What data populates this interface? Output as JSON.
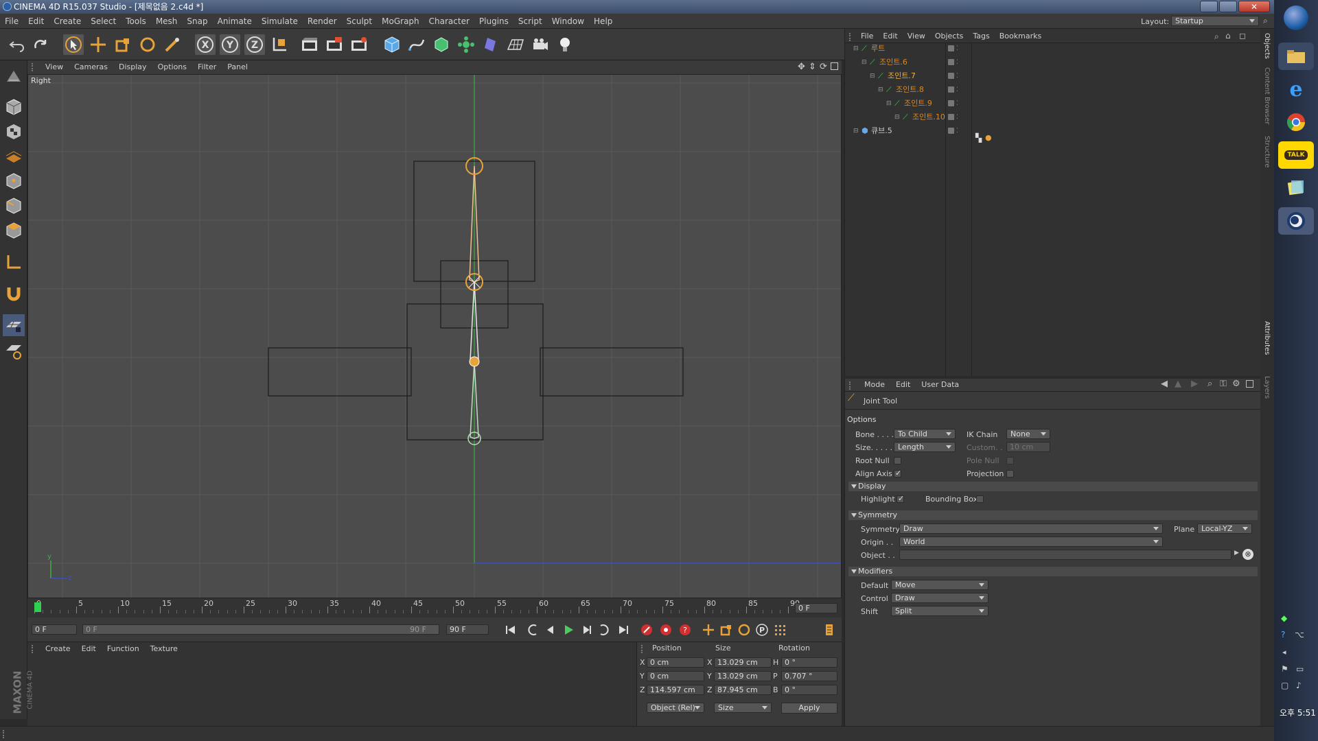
{
  "window": {
    "title": "CINEMA 4D R15.037 Studio - [제목없음 2.c4d *]",
    "layout_label": "Layout:",
    "layout_value": "Startup"
  },
  "menu": [
    "File",
    "Edit",
    "Create",
    "Select",
    "Tools",
    "Mesh",
    "Snap",
    "Animate",
    "Simulate",
    "Render",
    "Sculpt",
    "MoGraph",
    "Character",
    "Plugins",
    "Script",
    "Window",
    "Help"
  ],
  "toolbar": {
    "icons": [
      "undo-icon",
      "redo-icon",
      "select-arrow-icon",
      "move-icon",
      "scale-icon",
      "rotate-icon",
      "joint-tool-icon",
      "x-axis-lock-icon",
      "y-axis-lock-icon",
      "z-axis-lock-icon",
      "world-coordinates-icon",
      "render-view-icon",
      "render-picture-viewer-icon",
      "render-settings-icon",
      "cube-primitive-icon",
      "spline-pen-icon",
      "subdivision-surface-icon",
      "array-icon",
      "deformer-icon",
      "floor-icon",
      "camera-icon",
      "light-icon"
    ]
  },
  "viewport": {
    "menu": [
      "View",
      "Cameras",
      "Display",
      "Options",
      "Filter",
      "Panel"
    ],
    "label": "Right",
    "axis_y": "y",
    "axis_z": "z"
  },
  "timeline": {
    "ticks": [
      "0",
      "5",
      "10",
      "15",
      "20",
      "25",
      "30",
      "35",
      "40",
      "45",
      "50",
      "55",
      "60",
      "65",
      "70",
      "75",
      "80",
      "85",
      "90"
    ],
    "current_frame_field": "0 F",
    "start_field": "0 F",
    "range_start": "0 F",
    "range_end": "90 F",
    "end_field": "90 F"
  },
  "material_panel": {
    "menu": [
      "Create",
      "Edit",
      "Function",
      "Texture"
    ],
    "brand_top": "MAXON",
    "brand_bottom": "CINEMA 4D"
  },
  "coordinates": {
    "headers": {
      "position": "Position",
      "size": "Size",
      "rotation": "Rotation"
    },
    "rows": [
      {
        "pos_axis": "X",
        "pos": "0 cm",
        "size_axis": "X",
        "size": "13.029 cm",
        "rot_axis": "H",
        "rot": "0 °"
      },
      {
        "pos_axis": "Y",
        "pos": "0 cm",
        "size_axis": "Y",
        "size": "13.029 cm",
        "rot_axis": "P",
        "rot": "0.707 °"
      },
      {
        "pos_axis": "Z",
        "pos": "114.597 cm",
        "size_axis": "Z",
        "size": "87.945 cm",
        "rot_axis": "B",
        "rot": "0 °"
      }
    ],
    "mode_dropdown": "Object (Rel)",
    "size_dropdown": "Size",
    "apply_label": "Apply"
  },
  "object_manager": {
    "menu": [
      "File",
      "Edit",
      "View",
      "Objects",
      "Tags",
      "Bookmarks"
    ],
    "tree": [
      {
        "name": "루트",
        "indent": 0,
        "color": "orange"
      },
      {
        "name": "조인트.6",
        "indent": 1,
        "color": "orange"
      },
      {
        "name": "조인트.7",
        "indent": 2,
        "color": "orange-bright"
      },
      {
        "name": "조인트.8",
        "indent": 3,
        "color": "orange"
      },
      {
        "name": "조인트.9",
        "indent": 4,
        "color": "orange"
      },
      {
        "name": "조인트.10",
        "indent": 5,
        "color": "orange"
      },
      {
        "name": "큐브.5",
        "indent": 0,
        "color": "grey"
      }
    ]
  },
  "attributes": {
    "menu": [
      "Mode",
      "Edit",
      "User Data"
    ],
    "tool_name": "Joint Tool",
    "options_header": "Options",
    "bone_label": "Bone . . . .",
    "bone_value": "To Child",
    "ik_chain_label": "IK Chain",
    "ik_chain_value": "None",
    "size_label": "Size. . . . .",
    "size_value": "Length",
    "custom_label": "Custom. .",
    "custom_value": "10 cm",
    "root_null_label": "Root Null",
    "pole_null_label": "Pole Null",
    "align_axis_label": "Align Axis",
    "projection_label": "Projection",
    "display_header": "Display",
    "highlight_label": "Highlight",
    "bounding_box_label": "Bounding Box",
    "symmetry_header": "Symmetry",
    "symmetry_label": "Symmetry",
    "symmetry_value": "Draw",
    "plane_label": "Plane",
    "plane_value": "Local-YZ",
    "origin_label": "Origin . .",
    "origin_value": "World",
    "object_label": "Object . .",
    "modifiers_header": "Modifiers",
    "default_label": "Default",
    "default_value": "Move",
    "control_label": "Control",
    "control_value": "Draw",
    "shift_label": "Shift",
    "shift_value": "Split"
  },
  "side_tabs": [
    "Objects",
    "Content Browser",
    "Structure",
    "Attributes",
    "Layers"
  ],
  "taskbar": {
    "clock": "오후 5:51"
  },
  "colors": {
    "joint_orange": "#e8a23a",
    "viewport_bg": "#4c4c4c",
    "grid_line": "#5a5a5a",
    "y_axis_green": "#3fae3f",
    "z_axis_blue": "#3a4fd0"
  }
}
